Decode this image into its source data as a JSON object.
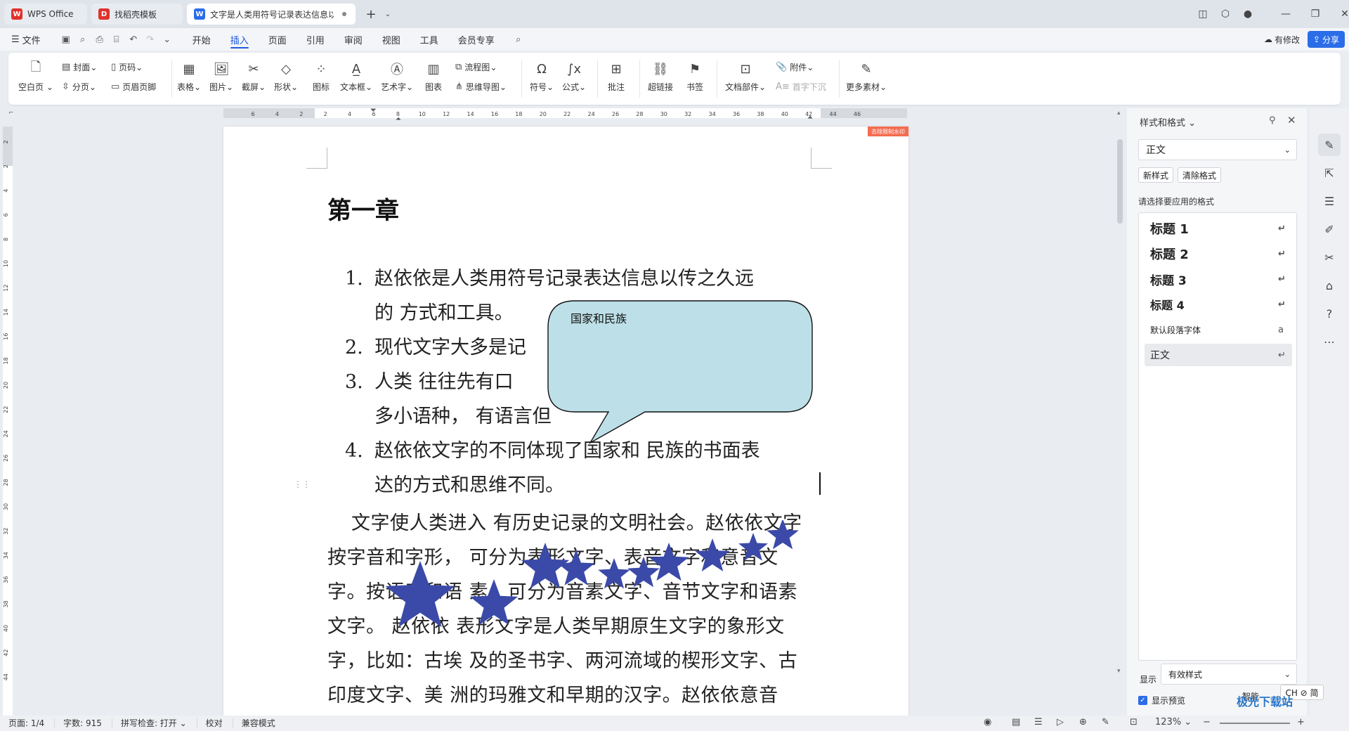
{
  "tabs": [
    {
      "label": "WPS Office",
      "icon": "wps-logo-icon",
      "color": "#e0312c"
    },
    {
      "label": "找稻壳模板",
      "icon": "docer-icon",
      "color": "#e0312c"
    },
    {
      "label": "文字是人类用符号记录表达信息以",
      "icon": "word-doc-icon",
      "color": "#2b6de8"
    }
  ],
  "menu": {
    "file": "文件",
    "items": [
      "开始",
      "插入",
      "页面",
      "引用",
      "审阅",
      "视图",
      "工具",
      "会员专享"
    ],
    "active": "插入",
    "modified": "有修改",
    "share": "分享"
  },
  "ribbon": {
    "blank_page": "空白页",
    "cover": "封面",
    "page_num": "页码",
    "page_break": "分页",
    "header_footer": "页眉页脚",
    "table": "表格",
    "image": "图片",
    "screenshot": "截屏",
    "shape": "形状",
    "icon": "图标",
    "textbox": "文本框",
    "wordart": "艺术字",
    "chart": "图表",
    "flowchart": "流程图",
    "mindmap": "思维导图",
    "symbol": "符号",
    "formula": "公式",
    "comment": "批注",
    "hyperlink": "超链接",
    "bookmark": "书签",
    "doc_parts": "文档部件",
    "attachment": "附件",
    "drop_cap": "首字下沉",
    "more": "更多素材"
  },
  "ruler": {
    "top_ticks": [
      "6",
      "4",
      "2",
      "2",
      "4",
      "6",
      "8",
      "10",
      "12",
      "14",
      "16",
      "18",
      "20",
      "22",
      "24",
      "26",
      "28",
      "30",
      "32",
      "34",
      "36",
      "38",
      "40",
      "42",
      "44",
      "46"
    ],
    "left_ticks": [
      "2",
      "2",
      "4",
      "6",
      "8",
      "10",
      "12",
      "14",
      "16",
      "18",
      "20",
      "22",
      "24",
      "26",
      "28",
      "30",
      "32",
      "34",
      "36",
      "38",
      "40",
      "42",
      "44"
    ]
  },
  "document": {
    "watermark_tag": "去除限制水印",
    "title": "第一章",
    "list": [
      {
        "num": "1.",
        "lines": [
          "赵依依是人类用符号记录表达信息以传之久远",
          "的 方式和工具。"
        ]
      },
      {
        "num": "2.",
        "lines": [
          "现代文字大多是记"
        ]
      },
      {
        "num": "3.",
        "lines": [
          "人类 往往先有口",
          "多小语种， 有语言但"
        ]
      },
      {
        "num": "4.",
        "lines": [
          "赵依依文字的不同体现了国家和 民族的书面表",
          "达的方式和思维不同。"
        ]
      }
    ],
    "paragraph": "文字使人类进入 有历史记录的文明社会。赵依依文字按字音和字形， 可分为表形文字、表音文字和意音文字。按语音和语 素，可分为音素文字、音节文字和语素文字。 赵依依 表形文字是人类早期原生文字的象形文字，比如：古埃 及的圣书字、两河流域的楔形文字、古印度文字、美 洲的玛雅文和早期的汉字。赵依依意音",
    "callout_text": "国家和民族",
    "callout_color": "#bde0e8",
    "star_color": "#3b4aa8"
  },
  "styles_panel": {
    "title": "样式和格式",
    "current": "正文",
    "new_style": "新样式",
    "clear_format": "清除格式",
    "hint": "请选择要应用的格式",
    "items": [
      {
        "name": "标题 1",
        "mark": "↵"
      },
      {
        "name": "标题 2",
        "mark": "↵"
      },
      {
        "name": "标题 3",
        "mark": "↵"
      },
      {
        "name": "标题 4",
        "mark": "↵"
      },
      {
        "name": "默认段落字体",
        "mark": "a"
      },
      {
        "name": "正文",
        "mark": "↵"
      }
    ],
    "show_label": "显示",
    "show_value": "有效样式",
    "preview_label": "显示预览",
    "smart_label": "智能"
  },
  "statusbar": {
    "page": "页面: 1/4",
    "words": "字数: 915",
    "spell": "拼写检查: 打开",
    "proof": "校对",
    "compat": "兼容模式",
    "zoom": "123%"
  },
  "ime": "CH ⊘ 简",
  "brand_watermark": "极光下载站"
}
